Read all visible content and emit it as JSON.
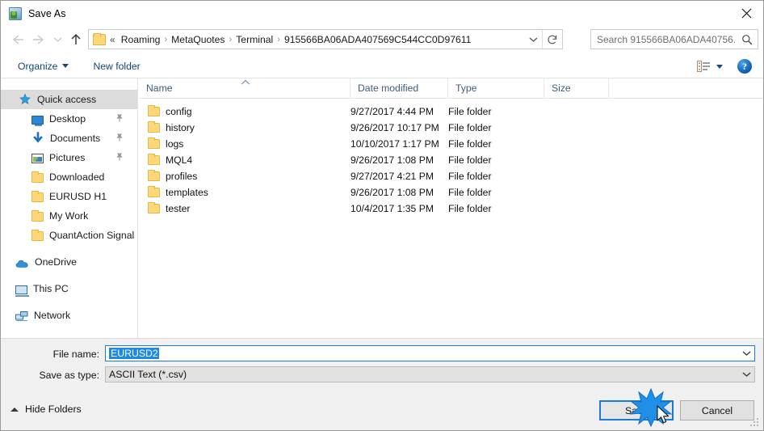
{
  "window": {
    "title": "Save As",
    "icon": "save-as-icon",
    "close_label": "✕"
  },
  "nav": {
    "back": "back-arrow",
    "forward": "forward-arrow",
    "recent": "recent-locations-chevron",
    "up": "up-arrow"
  },
  "address": {
    "folder_icon": "folder-icon",
    "lead": "«",
    "separator": "›",
    "crumbs": [
      "Roaming",
      "MetaQuotes",
      "Terminal",
      "915566BA06ADA407569C544CC0D97611"
    ],
    "dropdown_icon": "chevron-down-icon",
    "refresh_icon": "refresh-icon"
  },
  "search": {
    "placeholder": "Search 915566BA06ADA40756...",
    "value": "",
    "icon": "search-icon"
  },
  "toolbar": {
    "organize": "Organize",
    "new_folder": "New folder",
    "view_icon": "view-mode-icon",
    "view_caret": "chevron-down-icon",
    "help": "?"
  },
  "sidebar": {
    "items": [
      {
        "label": "Quick access",
        "icon": "star-icon",
        "level": 0,
        "selected": true,
        "pinned": false
      },
      {
        "label": "Desktop",
        "icon": "monitor-icon",
        "level": 1,
        "selected": false,
        "pinned": true
      },
      {
        "label": "Documents",
        "icon": "download-icon",
        "level": 1,
        "selected": false,
        "pinned": true
      },
      {
        "label": "Pictures",
        "icon": "pictures-icon",
        "level": 1,
        "selected": false,
        "pinned": true
      },
      {
        "label": "Downloaded",
        "icon": "folder-icon",
        "level": 1,
        "selected": false,
        "pinned": false
      },
      {
        "label": "EURUSD H1",
        "icon": "folder-icon",
        "level": 1,
        "selected": false,
        "pinned": false
      },
      {
        "label": "My Work",
        "icon": "folder-icon",
        "level": 1,
        "selected": false,
        "pinned": false
      },
      {
        "label": "QuantAction Signal",
        "icon": "folder-icon",
        "level": 1,
        "selected": false,
        "pinned": false
      },
      {
        "label": "OneDrive",
        "icon": "cloud-icon",
        "level": 0,
        "selected": false,
        "pinned": false
      },
      {
        "label": "This PC",
        "icon": "pc-icon",
        "level": 0,
        "selected": false,
        "pinned": false
      },
      {
        "label": "Network",
        "icon": "network-icon",
        "level": 0,
        "selected": false,
        "pinned": false
      }
    ]
  },
  "filelist": {
    "columns": [
      "Name",
      "Date modified",
      "Type",
      "Size"
    ],
    "sort_indicator": "sort-ascending-icon",
    "rows": [
      {
        "name": "config",
        "date": "9/27/2017 4:44 PM",
        "type": "File folder",
        "size": ""
      },
      {
        "name": "history",
        "date": "9/26/2017 10:17 PM",
        "type": "File folder",
        "size": ""
      },
      {
        "name": "logs",
        "date": "10/10/2017 1:17 PM",
        "type": "File folder",
        "size": ""
      },
      {
        "name": "MQL4",
        "date": "9/26/2017 1:08 PM",
        "type": "File folder",
        "size": ""
      },
      {
        "name": "profiles",
        "date": "9/27/2017 4:21 PM",
        "type": "File folder",
        "size": ""
      },
      {
        "name": "templates",
        "date": "9/26/2017 1:08 PM",
        "type": "File folder",
        "size": ""
      },
      {
        "name": "tester",
        "date": "10/4/2017 1:35 PM",
        "type": "File folder",
        "size": ""
      }
    ]
  },
  "footer": {
    "filename_label": "File name:",
    "filename_value": "EURUSD2",
    "savetype_label": "Save as type:",
    "savetype_value": "ASCII Text (*.csv)",
    "combo_caret": "chevron-down-icon",
    "save_button": "Save",
    "cancel_button": "Cancel",
    "hide_folders": "Hide Folders",
    "hide_folders_caret": "chevron-up-icon"
  },
  "colors": {
    "accent": "#1a7bd4",
    "selection": "#1e88e5",
    "link": "#13457c",
    "folder": "#ffd778",
    "sidebar_selected": "#dcdcdc",
    "footer_bg": "#f0f0f0"
  }
}
